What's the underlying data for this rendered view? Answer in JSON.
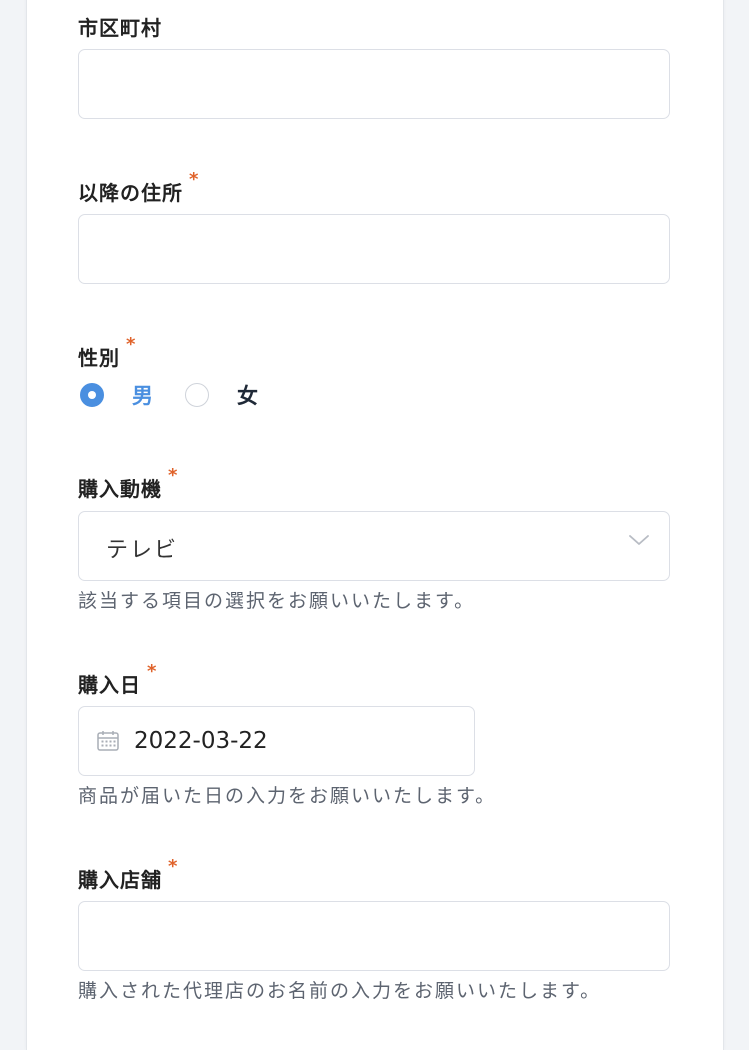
{
  "fields": {
    "city": {
      "label": "市区町村"
    },
    "address": {
      "label": "以降の住所",
      "required_mark": "*"
    },
    "gender": {
      "label": "性別",
      "required_mark": "*",
      "options": [
        {
          "label": "男",
          "selected": true
        },
        {
          "label": "女",
          "selected": false
        }
      ]
    },
    "motive": {
      "label": "購入動機",
      "required_mark": "*",
      "value": "テレビ",
      "help": "該当する項目の選択をお願いいたします。"
    },
    "purchase_date": {
      "label": "購入日",
      "required_mark": "*",
      "value": "2022-03-22",
      "help": "商品が届いた日の入力をお願いいたします。"
    },
    "store": {
      "label": "購入店舗",
      "required_mark": "*",
      "help": "購入された代理店のお名前の入力をお願いいたします。"
    }
  },
  "colors": {
    "accent": "#4a8fe0",
    "required": "#e0632b",
    "border": "#dcdfe6",
    "help_text": "#5d6470"
  },
  "icons": {
    "select": "chevron-down-icon",
    "date": "calendar-icon"
  }
}
